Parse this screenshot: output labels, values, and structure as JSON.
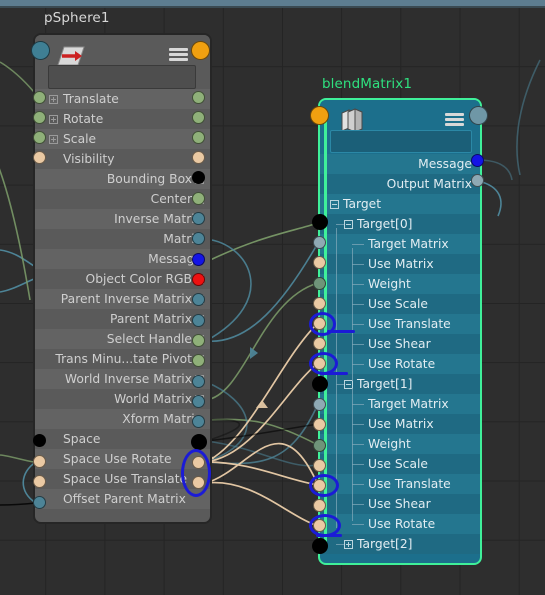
{
  "app": {
    "name": "maya-node-editor",
    "background_color": "#2e2e2e",
    "grid_color": "#242424",
    "topbar_color": "#5d7d90"
  },
  "nodes": [
    {
      "id": "psphere",
      "title": "pSphere1",
      "title_color": "#d8d8d8",
      "selected": false,
      "body_color": "#5a5a5a",
      "name_field_value": "",
      "icon": "transform-node-icon",
      "menu_icon": "hamburger-icon",
      "header_left_port_color": "#3f7f94",
      "header_right_port_color": "#f0a010",
      "attributes": [
        {
          "label": "Translate",
          "align": "left",
          "expand": "plus",
          "in_color": "#8fb079",
          "out_color": "#8fb079"
        },
        {
          "label": "Rotate",
          "align": "left",
          "expand": "plus",
          "in_color": "#8fb079",
          "out_color": "#8fb079"
        },
        {
          "label": "Scale",
          "align": "left",
          "expand": "plus",
          "in_color": "#8fb079",
          "out_color": "#8fb079"
        },
        {
          "label": "Visibility",
          "align": "left",
          "expand": "none",
          "in_color": "#eac9a3",
          "out_color": "#eac9a3"
        },
        {
          "label": "Bounding Box",
          "align": "right",
          "expand": "plus",
          "in_color": null,
          "out_color": "#000000"
        },
        {
          "label": "Center",
          "align": "right",
          "expand": "plus",
          "in_color": null,
          "out_color": "#8fb079"
        },
        {
          "label": "Inverse Matrix",
          "align": "right",
          "expand": "none",
          "in_color": null,
          "out_color": "#4d8497"
        },
        {
          "label": "Matrix",
          "align": "right",
          "expand": "none",
          "in_color": null,
          "out_color": "#4d8497"
        },
        {
          "label": "Message",
          "align": "right",
          "expand": "none",
          "in_color": null,
          "out_color": "#1414e6"
        },
        {
          "label": "Object Color RGB",
          "align": "right",
          "expand": "plus",
          "in_color": null,
          "out_color": "#ee1111"
        },
        {
          "label": "Parent Inverse Matrix",
          "align": "right",
          "expand": "plus",
          "in_color": null,
          "out_color": "#4d8497"
        },
        {
          "label": "Parent Matrix",
          "align": "right",
          "expand": "plus",
          "in_color": null,
          "out_color": "#4d8497"
        },
        {
          "label": "Select Handle",
          "align": "right",
          "expand": "plus",
          "in_color": null,
          "out_color": "#8fb079"
        },
        {
          "label": "Trans Minu...tate Pivot",
          "align": "right",
          "expand": "plus",
          "in_color": null,
          "out_color": "#8fb079"
        },
        {
          "label": "World Inverse Matrix",
          "align": "right",
          "expand": "plus",
          "in_color": null,
          "out_color": "#4d8497"
        },
        {
          "label": "World Matrix",
          "align": "right",
          "expand": "plus",
          "in_color": null,
          "out_color": "#4d8497"
        },
        {
          "label": "Xform Matrix",
          "align": "right",
          "expand": "none",
          "in_color": null,
          "out_color": "#4d8497"
        },
        {
          "label": "Space",
          "align": "left",
          "expand": "none",
          "in_color": "#000000",
          "out_color": "#000000"
        },
        {
          "label": "Space Use Rotate",
          "align": "left",
          "expand": "none",
          "in_color": "#eac9a3",
          "out_color": "#eac9a3"
        },
        {
          "label": "Space Use Translate",
          "align": "left",
          "expand": "none",
          "in_color": "#eac9a3",
          "out_color": "#eac9a3"
        },
        {
          "label": "Offset Parent Matrix",
          "align": "left",
          "expand": "none",
          "in_color": "#4d8497",
          "out_color": null
        }
      ]
    },
    {
      "id": "blendmatrix",
      "title": "blendMatrix1",
      "title_color": "#2fe07f",
      "selected": true,
      "selection_color": "#3ff09a",
      "body_color": "#1c6f8c",
      "name_field_value": "",
      "icon": "blend-matrix-node-icon",
      "menu_icon": "hamburger-icon",
      "header_left_port_color": "#f0a010",
      "header_right_port_color": "#6f97a6",
      "attributes": [
        {
          "label": "Message",
          "align": "right",
          "indent": 0,
          "expand": "none",
          "out_color": "#1414e6",
          "in_color": null
        },
        {
          "label": "Output Matrix",
          "align": "right",
          "indent": 0,
          "expand": "none",
          "out_color": "#8fa9b4",
          "in_color": null
        },
        {
          "label": "Target",
          "align": "left",
          "indent": 0,
          "expand": "minus",
          "in_color": null,
          "out_color": null
        },
        {
          "label": "Target[0]",
          "align": "left",
          "indent": 1,
          "expand": "minus",
          "in_color": "#000000",
          "out_color": null
        },
        {
          "label": "Target Matrix",
          "align": "left",
          "indent": 2,
          "expand": "none",
          "in_color": "#8fa9b4",
          "out_color": null
        },
        {
          "label": "Use Matrix",
          "align": "left",
          "indent": 2,
          "expand": "none",
          "in_color": "#eac9a3",
          "out_color": null
        },
        {
          "label": "Weight",
          "align": "left",
          "indent": 2,
          "expand": "none",
          "in_color": "#6f9479",
          "out_color": null
        },
        {
          "label": "Use Scale",
          "align": "left",
          "indent": 2,
          "expand": "none",
          "in_color": "#eac9a3",
          "out_color": null
        },
        {
          "label": "Use Translate",
          "align": "left",
          "indent": 2,
          "expand": "none",
          "in_color": "#eac9a3",
          "out_color": null,
          "annotated": true
        },
        {
          "label": "Use Shear",
          "align": "left",
          "indent": 2,
          "expand": "none",
          "in_color": "#eac9a3",
          "out_color": null
        },
        {
          "label": "Use Rotate",
          "align": "left",
          "indent": 2,
          "expand": "none",
          "in_color": "#eac9a3",
          "out_color": null,
          "annotated": true
        },
        {
          "label": "Target[1]",
          "align": "left",
          "indent": 1,
          "expand": "minus",
          "in_color": "#000000",
          "out_color": null
        },
        {
          "label": "Target Matrix",
          "align": "left",
          "indent": 2,
          "expand": "none",
          "in_color": "#8fa9b4",
          "out_color": null
        },
        {
          "label": "Use Matrix",
          "align": "left",
          "indent": 2,
          "expand": "none",
          "in_color": "#eac9a3",
          "out_color": null
        },
        {
          "label": "Weight",
          "align": "left",
          "indent": 2,
          "expand": "none",
          "in_color": "#6f9479",
          "out_color": null
        },
        {
          "label": "Use Scale",
          "align": "left",
          "indent": 2,
          "expand": "none",
          "in_color": "#eac9a3",
          "out_color": null
        },
        {
          "label": "Use Translate",
          "align": "left",
          "indent": 2,
          "expand": "none",
          "in_color": "#eac9a3",
          "out_color": null,
          "annotated": true
        },
        {
          "label": "Use Shear",
          "align": "left",
          "indent": 2,
          "expand": "none",
          "in_color": "#eac9a3",
          "out_color": null
        },
        {
          "label": "Use Rotate",
          "align": "left",
          "indent": 2,
          "expand": "none",
          "in_color": "#eac9a3",
          "out_color": null,
          "annotated": true
        },
        {
          "label": "Target[2]",
          "align": "left",
          "indent": 1,
          "expand": "plus",
          "in_color": "#000000",
          "out_color": null
        }
      ]
    }
  ],
  "annotations": {
    "color": "#1b1bd6",
    "description": "hand-drawn blue ellipses marking Use Translate / Use Rotate ports and Space Use Rotate / Space Use Translate ports"
  },
  "wire_colors": {
    "matrix": "#4d8497",
    "boolean": "#e2c6a3",
    "numeric": "#8fb079",
    "message": "#000000",
    "teal": "#4d8497"
  }
}
